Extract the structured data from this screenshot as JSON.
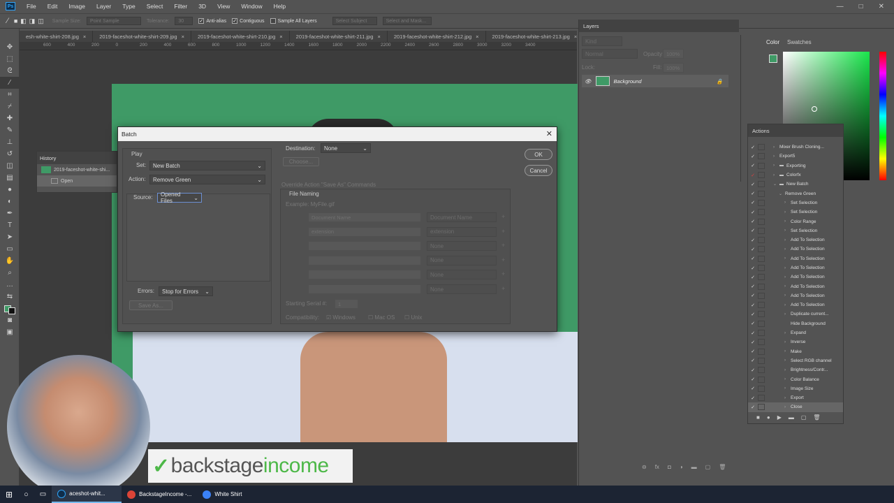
{
  "app": {
    "logo": "Ps"
  },
  "menu": [
    "File",
    "Edit",
    "Image",
    "Layer",
    "Type",
    "Select",
    "Filter",
    "3D",
    "View",
    "Window",
    "Help"
  ],
  "window_controls": [
    "—",
    "□",
    "✕"
  ],
  "options_bar": {
    "sample_size_label": "Sample Size:",
    "sample_size_value": "Point Sample",
    "tolerance_label": "Tolerance:",
    "tolerance_value": "30",
    "anti_alias": "Anti-alias",
    "contiguous": "Contiguous",
    "sample_all_layers": "Sample All Layers",
    "select_subject": "Select Subject",
    "select_and_mask": "Select and Mask..."
  },
  "tabs": [
    "esh-white-shirt-208.jpg",
    "2019-faceshot-white-shirt-209.jpg",
    "2019-faceshot-white-shirt-210.jpg",
    "2019-faceshot-white-shirt-211.jpg",
    "2019-faceshot-white-shirt-212.jpg",
    "2019-faceshot-white-shirt-213.jpg"
  ],
  "ruler_ticks": [
    "600",
    "400",
    "200",
    "0",
    "200",
    "400",
    "600",
    "800",
    "1000",
    "1200",
    "1400",
    "1600",
    "1800",
    "2000",
    "2200",
    "2400",
    "2600",
    "2800",
    "3000",
    "3200",
    "3400"
  ],
  "history": {
    "title": "History",
    "snapshot": "2019-faceshot-white-shi...",
    "step": "Open"
  },
  "dialog": {
    "title": "Batch",
    "play_label": "Play",
    "set_label": "Set:",
    "set_value": "New Batch",
    "action_label": "Action:",
    "action_value": "Remove Green",
    "source_label": "Source:",
    "source_value": "Opened Files",
    "errors_label": "Errors:",
    "errors_value": "Stop for Errors",
    "save_as": "Save As...",
    "destination_label": "Destination:",
    "destination_value": "None",
    "choose": "Choose...",
    "override": "Override Action \"Save As\" Commands",
    "file_naming": "File Naming",
    "example": "Example: MyFile.gif",
    "naming_rows": [
      {
        "left": "Document Name",
        "right": "Document Name"
      },
      {
        "left": "extension",
        "right": "extension"
      },
      {
        "left": "",
        "right": "None"
      },
      {
        "left": "",
        "right": "None"
      },
      {
        "left": "",
        "right": "None"
      },
      {
        "left": "",
        "right": "None"
      }
    ],
    "starting_serial_label": "Starting Serial #:",
    "starting_serial_value": "1",
    "compatibility_label": "Compatibility:",
    "compat_windows": "Windows",
    "compat_mac": "Mac OS",
    "compat_unix": "Unix",
    "ok": "OK",
    "cancel": "Cancel"
  },
  "layers": {
    "title": "Layers",
    "kind": "Kind",
    "blend": "Normal",
    "opacity_label": "Opacity:",
    "opacity_value": "100%",
    "lock_label": "Lock:",
    "fill_label": "Fill:",
    "fill_value": "100%",
    "layer_name": "Background"
  },
  "color_panel": {
    "tab_color": "Color",
    "tab_swatches": "Swatches"
  },
  "actions": {
    "title": "Actions",
    "rows": [
      {
        "label": "Mixer Brush Cloning...",
        "indent": 1,
        "kind": "set"
      },
      {
        "label": "Export5",
        "indent": 1,
        "kind": "action"
      },
      {
        "label": "Exporting",
        "indent": 1,
        "kind": "folder"
      },
      {
        "label": "Colorfx",
        "indent": 1,
        "kind": "folder"
      },
      {
        "label": "New Batch",
        "indent": 1,
        "kind": "folder-open"
      },
      {
        "label": "Remove Green",
        "indent": 2,
        "kind": "action-open"
      },
      {
        "label": "Set Selection",
        "indent": 3,
        "kind": "step"
      },
      {
        "label": "Set Selection",
        "indent": 3,
        "kind": "step"
      },
      {
        "label": "Color Range",
        "indent": 3,
        "kind": "step"
      },
      {
        "label": "Set Selection",
        "indent": 3,
        "kind": "step"
      },
      {
        "label": "Add To Selection",
        "indent": 3,
        "kind": "step"
      },
      {
        "label": "Add To Selection",
        "indent": 3,
        "kind": "step"
      },
      {
        "label": "Add To Selection",
        "indent": 3,
        "kind": "step"
      },
      {
        "label": "Add To Selection",
        "indent": 3,
        "kind": "step"
      },
      {
        "label": "Add To Selection",
        "indent": 3,
        "kind": "step"
      },
      {
        "label": "Add To Selection",
        "indent": 3,
        "kind": "step"
      },
      {
        "label": "Add To Selection",
        "indent": 3,
        "kind": "step"
      },
      {
        "label": "Add To Selection",
        "indent": 3,
        "kind": "step"
      },
      {
        "label": "Duplicate current...",
        "indent": 3,
        "kind": "step"
      },
      {
        "label": "Hide Background",
        "indent": 3,
        "kind": "step"
      },
      {
        "label": "Expand",
        "indent": 3,
        "kind": "step"
      },
      {
        "label": "Inverse",
        "indent": 3,
        "kind": "step"
      },
      {
        "label": "Make",
        "indent": 3,
        "kind": "step"
      },
      {
        "label": "Select RGB channel",
        "indent": 3,
        "kind": "step"
      },
      {
        "label": "Brightness/Contr...",
        "indent": 3,
        "kind": "step"
      },
      {
        "label": "Color Balance",
        "indent": 3,
        "kind": "step"
      },
      {
        "label": "Image Size",
        "indent": 3,
        "kind": "step"
      },
      {
        "label": "Export",
        "indent": 3,
        "kind": "step"
      },
      {
        "label": "Close",
        "indent": 3,
        "kind": "step"
      }
    ]
  },
  "brand": {
    "mark": "✓",
    "part1": "backstage",
    "part2": "income"
  },
  "taskbar": {
    "items": [
      {
        "label": "aceshot-whit...",
        "color": "#2fa3f7"
      },
      {
        "label": "BackstageIncome -...",
        "color": "#db4437"
      },
      {
        "label": "White Shirt",
        "color": "#3b82f6"
      }
    ]
  },
  "colors": {
    "green_screen": "#3f9a66",
    "accent": "#4db848"
  }
}
